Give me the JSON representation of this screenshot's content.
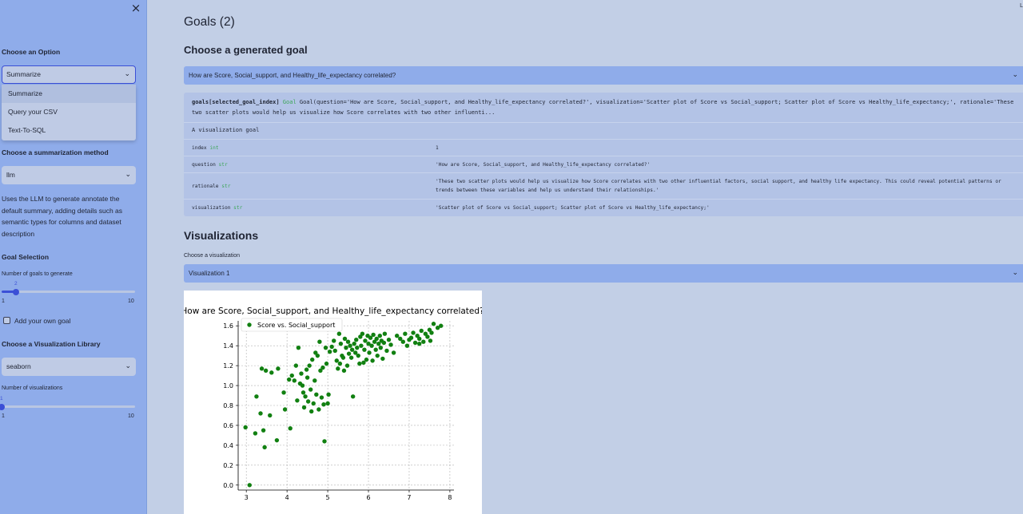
{
  "sidebar": {
    "close_icon": "×",
    "choose_option_label": "Choose an Option",
    "option_select_value": "Summarize",
    "option_menu": [
      "Summarize",
      "Query your CSV",
      "Text-To-SQL"
    ],
    "summarization_label": "Choose a summarization method",
    "summarization_value": "llm",
    "summarization_desc": "Uses the LLM to generate annotate the default summary, adding details such as semantic types for columns and dataset description",
    "goal_selection_label": "Goal Selection",
    "num_goals_label": "Number of goals to generate",
    "num_goals": {
      "value": "2",
      "min": "1",
      "max": "10",
      "fraction": 0.111
    },
    "add_goal_label": "Add your own goal",
    "viz_library_label": "Choose a Visualization Library",
    "viz_library_value": "seaborn",
    "num_viz_label": "Number of visualizations",
    "num_viz": {
      "value": "1",
      "min": "1",
      "max": "10",
      "fraction": 0.0
    }
  },
  "main": {
    "goals_title": "Goals (2)",
    "choose_goal_heading": "Choose a generated goal",
    "goal_select_value": "How are Score, Social_support, and Healthy_life_expectancy correlated?",
    "goal_code": {
      "var": "goals[selected_goal_index]",
      "type": "Goal",
      "text": "Goal(question='How are Score, Social_support, and Healthy_life_expectancy correlated?', visualization='Scatter plot of Score vs Social_support; Scatter plot of Score vs Healthy_life_expectancy;', rationale='These two scatter plots would help us visualize how Score correlates with two other influenti..."
    },
    "goal_subtitle": "A visualization goal",
    "goal_fields": [
      {
        "key": "index",
        "type": "int",
        "value": "1"
      },
      {
        "key": "question",
        "type": "str",
        "value": "'How are Score, Social_support, and Healthy_life_expectancy correlated?'"
      },
      {
        "key": "rationale",
        "type": "str",
        "value": "'These two scatter plots would help us visualize how Score correlates with two other influential factors, social support, and healthy life expectancy. This could reveal potential patterns or trends between these variables and help us understand their relationships.'"
      },
      {
        "key": "visualization",
        "type": "str",
        "value": "'Scatter plot of Score vs Social_support; Scatter plot of Score vs Healthy_life_expectancy;'"
      }
    ],
    "viz_heading": "Visualizations",
    "choose_viz_label": "Choose a visualization",
    "viz_select_value": "Visualization 1",
    "corner_mark": "L"
  },
  "colors": {
    "accent": "#3b4fd6",
    "point": "#118011",
    "type_green": "#3ea65a"
  },
  "chart_data": {
    "type": "scatter",
    "title": "How are Score, Social_support, and Healthy_life_expectancy correlated?",
    "xlabel": "",
    "ylabel": "",
    "legend": "Score vs. Social_support",
    "legend_position": "top-left",
    "grid": true,
    "xlim": [
      2.8,
      8.1
    ],
    "ylim": [
      -0.05,
      1.65
    ],
    "xticks": [
      "3",
      "4",
      "5",
      "6",
      "7",
      "8"
    ],
    "yticks": [
      "0.0",
      "0.2",
      "0.4",
      "0.6",
      "0.8",
      "1.0",
      "1.2",
      "1.4",
      "1.6"
    ],
    "points": [
      [
        3.08,
        0.0
      ],
      [
        2.98,
        0.58
      ],
      [
        3.22,
        0.52
      ],
      [
        3.45,
        0.38
      ],
      [
        3.35,
        0.72
      ],
      [
        3.42,
        0.55
      ],
      [
        3.25,
        0.89
      ],
      [
        3.38,
        1.17
      ],
      [
        3.48,
        1.15
      ],
      [
        3.62,
        1.13
      ],
      [
        3.78,
        1.17
      ],
      [
        3.58,
        0.7
      ],
      [
        3.75,
        0.45
      ],
      [
        3.92,
        0.93
      ],
      [
        3.95,
        0.76
      ],
      [
        4.08,
        0.57
      ],
      [
        4.05,
        1.06
      ],
      [
        4.12,
        1.1
      ],
      [
        4.18,
        1.05
      ],
      [
        4.22,
        1.2
      ],
      [
        4.25,
        0.85
      ],
      [
        4.28,
        1.38
      ],
      [
        4.32,
        1.02
      ],
      [
        4.35,
        1.12
      ],
      [
        4.38,
        1.0
      ],
      [
        4.4,
        0.93
      ],
      [
        4.42,
        0.78
      ],
      [
        4.45,
        0.89
      ],
      [
        4.48,
        1.16
      ],
      [
        4.5,
        1.08
      ],
      [
        4.52,
        0.84
      ],
      [
        4.55,
        1.2
      ],
      [
        4.58,
        0.96
      ],
      [
        4.6,
        0.74
      ],
      [
        4.62,
        1.26
      ],
      [
        4.65,
        0.82
      ],
      [
        4.68,
        1.05
      ],
      [
        4.7,
        1.33
      ],
      [
        4.72,
        0.91
      ],
      [
        4.75,
        1.3
      ],
      [
        4.78,
        0.76
      ],
      [
        4.8,
        1.44
      ],
      [
        4.82,
        1.15
      ],
      [
        4.85,
        0.88
      ],
      [
        4.88,
        1.18
      ],
      [
        4.9,
        0.81
      ],
      [
        4.92,
        0.44
      ],
      [
        4.95,
        1.38
      ],
      [
        4.97,
        1.22
      ],
      [
        5.0,
        0.82
      ],
      [
        5.02,
        0.91
      ],
      [
        5.05,
        1.34
      ],
      [
        5.1,
        1.39
      ],
      [
        5.15,
        1.45
      ],
      [
        5.18,
        1.35
      ],
      [
        5.22,
        1.25
      ],
      [
        5.25,
        1.17
      ],
      [
        5.28,
        1.52
      ],
      [
        5.3,
        1.22
      ],
      [
        5.32,
        1.42
      ],
      [
        5.35,
        1.3
      ],
      [
        5.38,
        1.28
      ],
      [
        5.4,
        1.15
      ],
      [
        5.42,
        1.47
      ],
      [
        5.45,
        1.38
      ],
      [
        5.48,
        1.2
      ],
      [
        5.5,
        1.44
      ],
      [
        5.52,
        1.32
      ],
      [
        5.55,
        1.4
      ],
      [
        5.58,
        1.28
      ],
      [
        5.6,
        1.36
      ],
      [
        5.62,
        0.89
      ],
      [
        5.65,
        1.42
      ],
      [
        5.68,
        1.33
      ],
      [
        5.7,
        1.46
      ],
      [
        5.72,
        1.38
      ],
      [
        5.75,
        1.3
      ],
      [
        5.78,
        1.22
      ],
      [
        5.8,
        1.49
      ],
      [
        5.82,
        1.4
      ],
      [
        5.85,
        1.52
      ],
      [
        5.88,
        1.23
      ],
      [
        5.9,
        1.36
      ],
      [
        5.92,
        1.45
      ],
      [
        5.95,
        1.26
      ],
      [
        5.98,
        1.5
      ],
      [
        6.0,
        1.42
      ],
      [
        6.02,
        1.33
      ],
      [
        6.05,
        1.48
      ],
      [
        6.08,
        1.4
      ],
      [
        6.1,
        1.25
      ],
      [
        6.12,
        1.51
      ],
      [
        6.15,
        1.44
      ],
      [
        6.18,
        1.36
      ],
      [
        6.2,
        1.47
      ],
      [
        6.22,
        1.3
      ],
      [
        6.25,
        1.42
      ],
      [
        6.28,
        1.5
      ],
      [
        6.3,
        1.38
      ],
      [
        6.32,
        1.45
      ],
      [
        6.35,
        1.27
      ],
      [
        6.38,
        1.43
      ],
      [
        6.4,
        1.52
      ],
      [
        6.45,
        1.35
      ],
      [
        6.5,
        1.46
      ],
      [
        6.55,
        1.41
      ],
      [
        6.62,
        1.33
      ],
      [
        6.7,
        1.5
      ],
      [
        6.78,
        1.47
      ],
      [
        6.85,
        1.44
      ],
      [
        6.9,
        1.52
      ],
      [
        6.95,
        1.4
      ],
      [
        7.0,
        1.46
      ],
      [
        7.05,
        1.48
      ],
      [
        7.1,
        1.53
      ],
      [
        7.15,
        1.43
      ],
      [
        7.2,
        1.5
      ],
      [
        7.25,
        1.47
      ],
      [
        7.3,
        1.55
      ],
      [
        7.35,
        1.44
      ],
      [
        7.4,
        1.52
      ],
      [
        7.45,
        1.49
      ],
      [
        7.5,
        1.56
      ],
      [
        7.55,
        1.53
      ],
      [
        7.6,
        1.62
      ],
      [
        7.7,
        1.58
      ],
      [
        7.78,
        1.6
      ],
      [
        7.52,
        1.45
      ],
      [
        7.25,
        1.42
      ]
    ]
  }
}
